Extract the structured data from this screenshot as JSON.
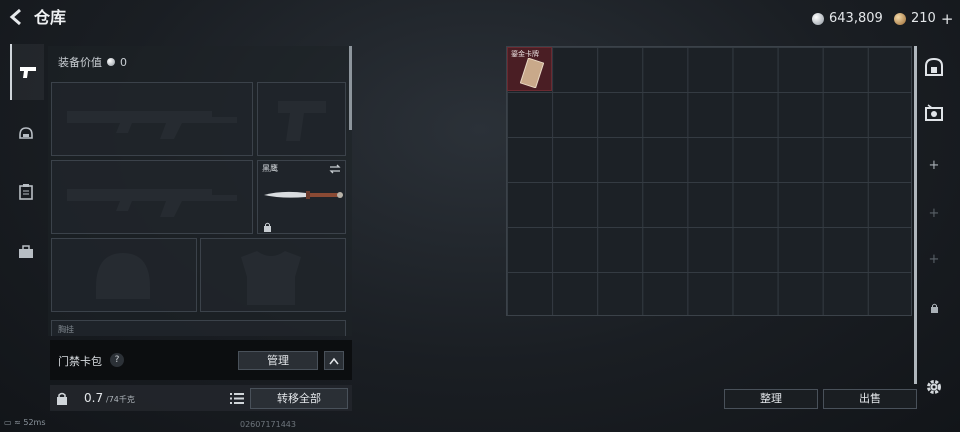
{
  "header": {
    "title": "仓库",
    "currency1": "643,809",
    "currency2": "210",
    "add": "+"
  },
  "equipment": {
    "label": "装备价值",
    "value": "0"
  },
  "knife": {
    "name": "黑鹰"
  },
  "partial_label": "胸挂",
  "cardbar": {
    "label": "门禁卡包",
    "help": "?",
    "manage": "管理"
  },
  "bottom": {
    "weight": "0.7",
    "capacity": "/74千克",
    "transfer_all": "转移全部"
  },
  "grid": {
    "item_label": "鎏金卡牌"
  },
  "actions": {
    "sort": "整理",
    "sell": "出售"
  },
  "status": {
    "ping": "52ms",
    "uid": "02607171443"
  },
  "colors": {
    "accent": "#2a2f35",
    "item_bg": "#4a1e24"
  }
}
